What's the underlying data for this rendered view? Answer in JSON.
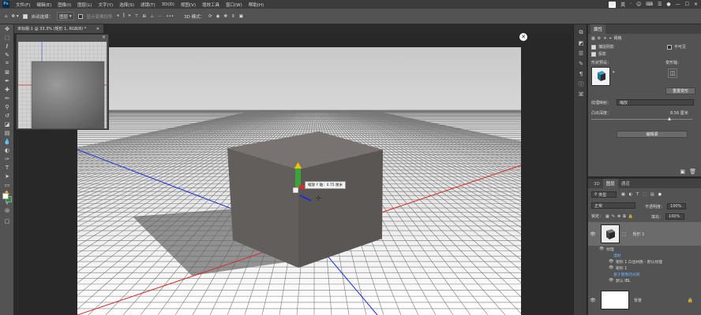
{
  "app": {
    "logo_text": "Ps"
  },
  "menu": [
    "文件(F)",
    "编辑(E)",
    "图像(I)",
    "图层(L)",
    "文字(Y)",
    "选择(S)",
    "滤镜(T)",
    "3D(D)",
    "视图(V)",
    "增效工具",
    "窗口(W)",
    "帮助(H)"
  ],
  "system_icons": [
    "S",
    "英",
    "·",
    "☺",
    "⌨",
    "☰",
    "●"
  ],
  "options_bar": {
    "auto_select_label": "自动选择：",
    "auto_select_value": "图层",
    "show_transform_label": "显示变换控件",
    "mode_3d_label": "3D 模式："
  },
  "document": {
    "tab_title": "未标题-1 @ 33.3% (矩形 1, RGB/8) *",
    "readout": "缩放 Y 轴：0.75 厘米"
  },
  "properties": {
    "tabs": [
      "属性"
    ],
    "panel_title": "网格",
    "catch_shadows_label": "捕捉阴影",
    "cast_shadows_label": "投影",
    "invisible_label": "不可见",
    "shape_preset_label": "形状预设：",
    "deform_axis_label": "变形轴：",
    "reset_deform_label": "重置变形",
    "texture_map_label": "纹理映射：",
    "texture_map_value": "缩放",
    "extrusion_depth_label": "凸出深度：",
    "extrusion_depth_value": "8.56 厘米",
    "edit_source_label": "编辑源"
  },
  "layers": {
    "tabs": [
      "3D",
      "图层",
      "通道"
    ],
    "filter_label": "类型",
    "blend_mode": "正常",
    "opacity_label": "不透明度：",
    "opacity_value": "100%",
    "lock_label": "锁定：",
    "fill_label": "填充：",
    "fill_value": "100%",
    "items": [
      {
        "name": "矩形 1",
        "type": "3d"
      },
      {
        "name": "背景",
        "type": "raster"
      }
    ],
    "sub_items": {
      "texture_label": "纹理",
      "diffuse_label": "漫射",
      "texture_1": "矩形 1 凸出材质 - 默认纹理",
      "texture_2": "矩形 1",
      "filter_label": "基于图像的光照",
      "default_ibl": "默认 IBL"
    }
  }
}
